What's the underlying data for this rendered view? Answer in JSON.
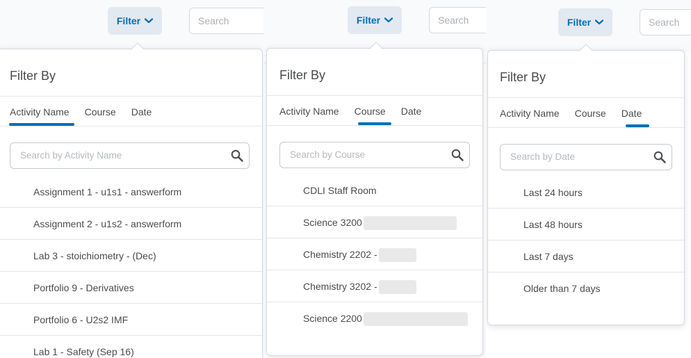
{
  "panel1": {
    "filter_label": "Filter",
    "top_search_placeholder": "Search",
    "dropdown_title": "Filter By",
    "tabs": [
      "Activity Name",
      "Course",
      "Date"
    ],
    "active_tab": "Activity Name",
    "search_placeholder": "Search by Activity Name",
    "items": [
      "Assignment 1 - u1s1 - answerform",
      "Assignment 2 - u1s2 - answerform",
      "Lab 3 - stoichiometry - (Dec)",
      "Portfolio 9 - Derivatives",
      "Portfolio 6 - U2s2 IMF",
      "Lab 1 - Safety (Sep 16)"
    ]
  },
  "panel2": {
    "filter_label": "Filter",
    "top_search_placeholder": "Search",
    "dropdown_title": "Filter By",
    "tabs": [
      "Activity Name",
      "Course",
      "Date"
    ],
    "active_tab": "Course",
    "search_placeholder": "Search by Course",
    "items": [
      "CDLI Staff Room",
      "Science 3200",
      "Chemistry 2202 -",
      "Chemistry 3202 -",
      "Science 2200"
    ]
  },
  "panel3": {
    "filter_label": "Filter",
    "top_search_placeholder": "Search",
    "dropdown_title": "Filter By",
    "tabs": [
      "Activity Name",
      "Course",
      "Date"
    ],
    "active_tab": "Date",
    "search_placeholder": "Search by Date",
    "items": [
      "Last 24 hours",
      "Last 48 hours",
      "Last 7 days",
      "Older than 7 days"
    ]
  },
  "colors": {
    "accent": "#006fbf",
    "filter_button_bg": "#e3e9f1",
    "text": "#494c4e",
    "divider": "#e3e6e9"
  }
}
